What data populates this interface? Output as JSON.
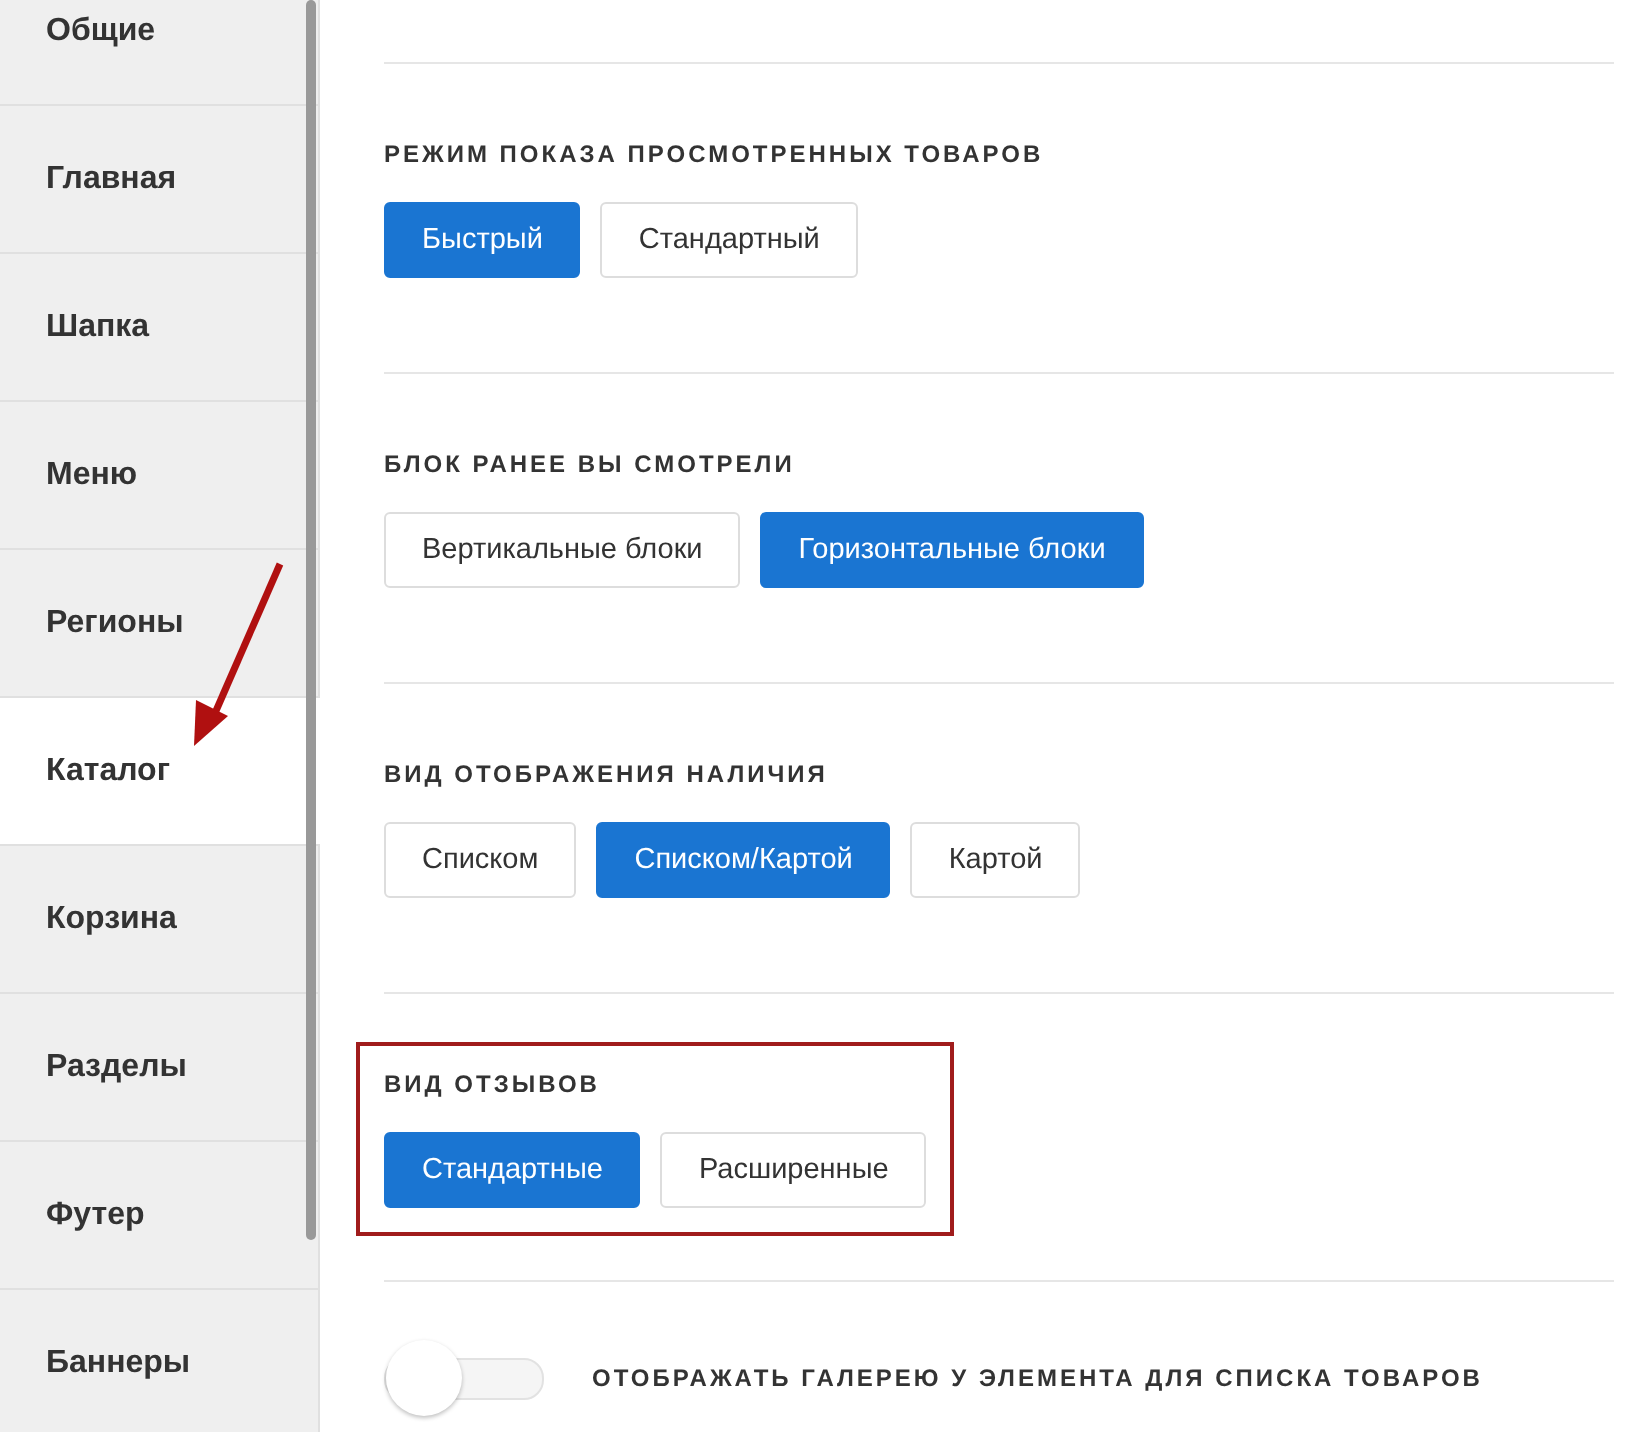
{
  "sidebar": {
    "items": [
      {
        "label": "Общие",
        "selected": false
      },
      {
        "label": "Главная",
        "selected": false
      },
      {
        "label": "Шапка",
        "selected": false
      },
      {
        "label": "Меню",
        "selected": false
      },
      {
        "label": "Регионы",
        "selected": false
      },
      {
        "label": "Каталог",
        "selected": true
      },
      {
        "label": "Корзина",
        "selected": false
      },
      {
        "label": "Разделы",
        "selected": false
      },
      {
        "label": "Футер",
        "selected": false
      },
      {
        "label": "Баннеры",
        "selected": false
      }
    ]
  },
  "sections": [
    {
      "title": "РЕЖИМ ПОКАЗА ПРОСМОТРЕННЫХ ТОВАРОВ",
      "highlighted": false,
      "options": [
        {
          "label": "Быстрый",
          "selected": true
        },
        {
          "label": "Стандартный",
          "selected": false
        }
      ]
    },
    {
      "title": "БЛОК РАНЕЕ ВЫ СМОТРЕЛИ",
      "highlighted": false,
      "options": [
        {
          "label": "Вертикальные блоки",
          "selected": false
        },
        {
          "label": "Горизонтальные блоки",
          "selected": true
        }
      ]
    },
    {
      "title": "ВИД ОТОБРАЖЕНИЯ НАЛИЧИЯ",
      "highlighted": false,
      "options": [
        {
          "label": "Списком",
          "selected": false
        },
        {
          "label": "Списком/Картой",
          "selected": true
        },
        {
          "label": "Картой",
          "selected": false
        }
      ]
    },
    {
      "title": "ВИД ОТЗЫВОВ",
      "highlighted": true,
      "options": [
        {
          "label": "Стандартные",
          "selected": true
        },
        {
          "label": "Расширенные",
          "selected": false
        }
      ]
    }
  ],
  "toggle": {
    "label": "ОТОБРАЖАТЬ ГАЛЕРЕЮ У ЭЛЕМЕНТА ДЛЯ СПИСКА ТОВАРОВ",
    "on": false
  }
}
